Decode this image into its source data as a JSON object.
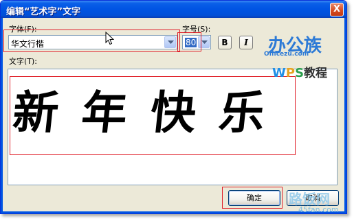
{
  "window": {
    "title": "编辑“艺术字”文字",
    "close_glyph": "X"
  },
  "font": {
    "label": "字体(F):",
    "value": "华文行楷"
  },
  "size": {
    "label": "字号(S):",
    "value": "80"
  },
  "style": {
    "bold_label": "B",
    "italic_label": "I"
  },
  "text": {
    "label": "文字(T):",
    "content": "新年快乐"
  },
  "buttons": {
    "ok": "确定",
    "cancel": "取消"
  },
  "watermark": {
    "brand_big": "办公族",
    "brand_url": "Officezu.com",
    "wps_w": "W",
    "wps_p": "P",
    "wps_s": "S",
    "wps_tail": "教程",
    "site_name": "路饭网",
    "site_url": "45fan.com"
  },
  "colors": {
    "title_bar": "#0054e3",
    "highlight_box": "#e0202a",
    "dialog_bg": "#ece9d8"
  }
}
